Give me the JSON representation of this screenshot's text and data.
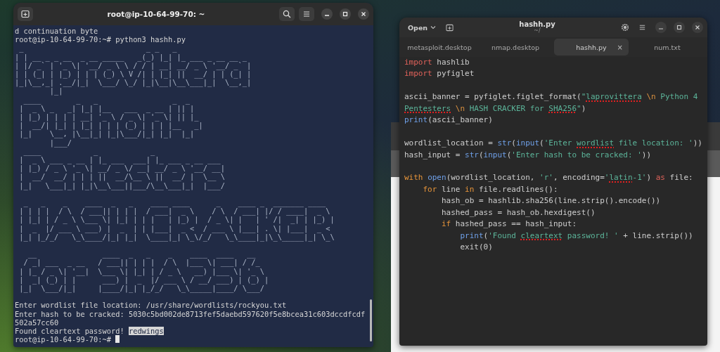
{
  "terminal": {
    "title": "root@ip-10-64-99-70: ~",
    "lines_before": [
      "d continuation byte",
      "root@ip-10-64-99-70:~# python3 hashh.py"
    ],
    "banner": [
      {
        "lines": [
          " _                            _ _   _",
          "| | __ _ _ __  _ __ _____   _(_) |_| |_ ___ _ __ __ _",
          "| |/ _` | '_ \\| '__/ _ \\ \\ / / | __| __/ _ \\ '__/ _` |",
          "| | (_| | |_) | | | (_) \\ V /| | |_| ||  __/ | | (_| |",
          "|_|\\__,_| .__/|_|  \\___/ \\_/ |_|\\__|\\__\\___|_|  \\__,_|",
          "        |_|"
        ]
      },
      {
        "lines": [
          "  ____        _   _                 _  _",
          " |  _ \\ _   _| |_| |__   ___  _ __ | || |",
          " | |_) | | | | __| '_ \\ / _ \\| '_ \\| || |_",
          " |  __/| |_| | |_| | | | (_) | | | |__   _|",
          " |_|    \\__, |\\__|_| |_|\\___/|_| |_|  |_|",
          "        |___/"
        ]
      },
      {
        "lines": [
          "  ____            _            _",
          " |  _ \\ ___ _ __ | |_ ___  ___| |_ ___ _ __ ___",
          " | |_) / _ \\ '_ \\| __/ _ \\/ __| __/ _ \\ '__/ __|",
          " |  __/  __/ | | | ||  __/\\__ \\ ||  __/ |  \\__ \\",
          " |_|   \\___|_| |_|\\__\\___||___/\\__\\___|_|  |___/"
        ]
      },
      {
        "lines": [
          "  _   _    _    ____  _   _    ____ ____      _    ____ _  _______ ____",
          " | | | |  / \\  / ___|| | | |  / ___|  _ \\    / \\  / ___| |/ / ____|  _ \\",
          " | |_| | / _ \\ \\___ \\| |_| | | |   | |_) |  / _ \\| |   | ' /|  _| | |_) |",
          " |  _  |/ ___ \\ ___) |  _  | | |___|  _ <  / ___ \\ |___| . \\| |___|  _ <",
          " |_| |_/_/   \\_\\____/|_| |_|  \\____|_| \\_\\/_/   \\_\\____|_|\\_\\_____|_| \\_\\"
        ]
      },
      {
        "lines": [
          "   __               ____  _   _    _    ____  ____   __",
          "  / _| ___  _ __   / ___|| | | |  / \\  |___ \\| ___| / /_",
          " | |_ / _ \\| '__|  \\___ \\| |_| | / _ \\   __) |___ \\| '_ \\",
          " |  _| (_) | |      ___) |  _  |/ ___ \\ / __/ ___) | (_) |",
          " |_|  \\___/|_|     |____/|_| |_/_/   \\_\\_____|____/ \\___/"
        ]
      }
    ],
    "lines_after": [
      {
        "segments": [
          {
            "text": "Enter wordlist file location: /usr/share/wordlists/rockyou.txt",
            "selected": false
          }
        ]
      },
      {
        "segments": [
          {
            "text": "Enter hash to be cracked: 5030c5bd002de8713fef5daebd597620f5e8bcea31c603dccdfcdf",
            "selected": false
          }
        ]
      },
      {
        "segments": [
          {
            "text": "502a57cc60",
            "selected": false
          }
        ]
      },
      {
        "segments": [
          {
            "text": "Found cleartext password! ",
            "selected": false
          },
          {
            "text": "redwings",
            "selected": true
          }
        ]
      },
      {
        "segments": [
          {
            "text": "root@ip-10-64-99-70:~#",
            "selected": false
          }
        ]
      }
    ],
    "cursor": true
  },
  "editor": {
    "open_button": "Open",
    "title": "hashh.py",
    "subtitle": "~/",
    "tabs": [
      {
        "label": "metasploit.desktop",
        "selected": false
      },
      {
        "label": "nmap.desktop",
        "selected": false
      },
      {
        "label": "hashh.py",
        "selected": true,
        "close": "×"
      },
      {
        "label": "num.txt",
        "selected": false
      }
    ],
    "code": [
      {
        "kind": "code",
        "tokens": [
          {
            "text": "import",
            "kind": "keyword"
          },
          {
            "text": " hashlib",
            "kind": "plain"
          }
        ]
      },
      {
        "kind": "code",
        "tokens": [
          {
            "text": "import",
            "kind": "keyword"
          },
          {
            "text": " pyfiglet",
            "kind": "plain"
          }
        ]
      },
      {
        "kind": "blank"
      },
      {
        "kind": "code",
        "tokens": [
          {
            "text": "ascii_banner = pyfiglet.figlet_format(",
            "kind": "plain"
          },
          {
            "text": "\"",
            "kind": "string"
          },
          {
            "text": "laprovittera",
            "kind": "misspelled"
          },
          {
            "text": " \\n",
            "kind": "escape"
          },
          {
            "text": " Python 4",
            "kind": "string"
          }
        ]
      },
      {
        "kind": "code",
        "tokens": [
          {
            "text": "Pentesters",
            "kind": "misspelled"
          },
          {
            "text": " \\n",
            "kind": "escape"
          },
          {
            "text": " HASH CRACKER for ",
            "kind": "string"
          },
          {
            "text": "SHA256",
            "kind": "misspelled"
          },
          {
            "text": "\"",
            "kind": "string"
          },
          {
            "text": ")",
            "kind": "plain"
          }
        ]
      },
      {
        "kind": "code",
        "tokens": [
          {
            "text": "print",
            "kind": "builtin"
          },
          {
            "text": "(ascii_banner)",
            "kind": "plain"
          }
        ]
      },
      {
        "kind": "blank"
      },
      {
        "kind": "code",
        "tokens": [
          {
            "text": "wordlist_location = ",
            "kind": "plain"
          },
          {
            "text": "str",
            "kind": "builtin"
          },
          {
            "text": "(",
            "kind": "plain"
          },
          {
            "text": "input",
            "kind": "builtin"
          },
          {
            "text": "(",
            "kind": "plain"
          },
          {
            "text": "'Enter ",
            "kind": "string"
          },
          {
            "text": "wordlist",
            "kind": "misspelled"
          },
          {
            "text": " file location: '",
            "kind": "string"
          },
          {
            "text": "))",
            "kind": "plain"
          }
        ]
      },
      {
        "kind": "code",
        "tokens": [
          {
            "text": "hash_input = ",
            "kind": "plain"
          },
          {
            "text": "str",
            "kind": "builtin"
          },
          {
            "text": "(",
            "kind": "plain"
          },
          {
            "text": "input",
            "kind": "builtin"
          },
          {
            "text": "(",
            "kind": "plain"
          },
          {
            "text": "'Enter hash to be cracked: '",
            "kind": "string"
          },
          {
            "text": "))",
            "kind": "plain"
          }
        ]
      },
      {
        "kind": "blank"
      },
      {
        "kind": "code",
        "tokens": [
          {
            "text": "with ",
            "kind": "control"
          },
          {
            "text": "open",
            "kind": "builtin"
          },
          {
            "text": "(wordlist_location, ",
            "kind": "plain"
          },
          {
            "text": "'r'",
            "kind": "string"
          },
          {
            "text": ", encoding=",
            "kind": "plain"
          },
          {
            "text": "'",
            "kind": "string"
          },
          {
            "text": "latin",
            "kind": "misspelled"
          },
          {
            "text": "-1'",
            "kind": "string"
          },
          {
            "text": ") ",
            "kind": "plain"
          },
          {
            "text": "as",
            "kind": "keyword"
          },
          {
            "text": " file:",
            "kind": "plain"
          }
        ]
      },
      {
        "kind": "code",
        "tokens": [
          {
            "text": "    for",
            "kind": "control"
          },
          {
            "text": " line ",
            "kind": "plain"
          },
          {
            "text": "in",
            "kind": "control"
          },
          {
            "text": " file.readlines():",
            "kind": "plain"
          }
        ]
      },
      {
        "kind": "code",
        "tokens": [
          {
            "text": "        hash_ob = hashlib.sha256(line.strip().encode())",
            "kind": "plain"
          }
        ]
      },
      {
        "kind": "code",
        "tokens": [
          {
            "text": "        hashed_pass = hash_ob.hexdigest()",
            "kind": "plain"
          }
        ]
      },
      {
        "kind": "code",
        "tokens": [
          {
            "text": "        if",
            "kind": "control"
          },
          {
            "text": " hashed_pass == hash_input:",
            "kind": "plain"
          }
        ]
      },
      {
        "kind": "code",
        "tokens": [
          {
            "text": "            print",
            "kind": "builtin"
          },
          {
            "text": "(",
            "kind": "plain"
          },
          {
            "text": "'Found ",
            "kind": "string"
          },
          {
            "text": "cleartext",
            "kind": "misspelled"
          },
          {
            "text": " password! '",
            "kind": "string"
          },
          {
            "text": " + line.strip())",
            "kind": "plain"
          }
        ]
      },
      {
        "kind": "code",
        "tokens": [
          {
            "text": "            exit(0)",
            "kind": "plain"
          }
        ]
      }
    ]
  }
}
